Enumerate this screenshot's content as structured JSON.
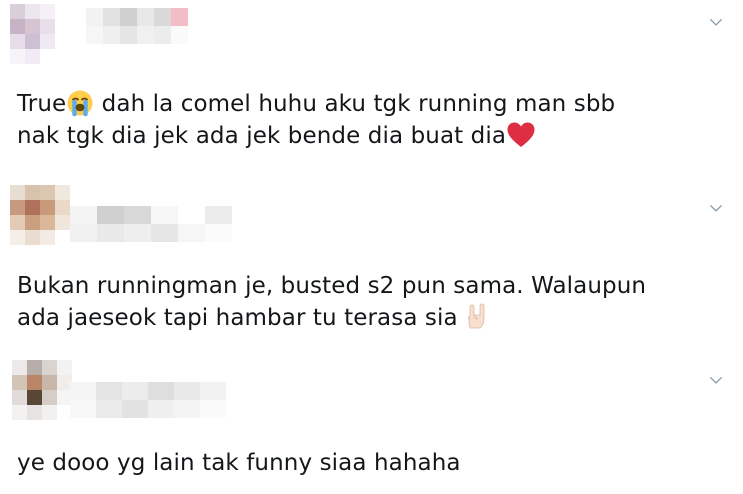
{
  "replies": [
    {
      "line1_before": "True",
      "line1_emoji": "loudly-crying-face-emoji",
      "line1_after": " dah la comel huhu aku tgk running man sbb",
      "line2_before": "nak tgk dia jek ada jek bende dia buat dia",
      "line2_emoji": "red-heart-emoji",
      "avatar_colors": [
        "#d9cfda",
        "#ece6ee",
        "#f4f0f6",
        "#ffffff",
        "#c8b3c6",
        "#d6c4d3",
        "#e8dfea",
        "#ffffff",
        "#e6dcea",
        "#cdbfd4",
        "#efe9f3",
        "#ffffff",
        "#f7f4f9",
        "#f0ebf4",
        "#ffffff",
        "#ffffff"
      ],
      "name_colors": [
        "#f2f2f2",
        "#e1e1e1",
        "#cfcfcf",
        "#e8e8e8",
        "#d9d9d9",
        "#f3bcc6",
        "#f6f6f6",
        "#efefef",
        "#e5e5e5",
        "#f0f0f0",
        "#ececec",
        "#fafafa"
      ]
    },
    {
      "line1": "Bukan runningman je, busted s2 pun sama. Walaupun",
      "line2_before": "ada jaeseok tapi hambar tu terasa sia",
      "line2_emoji": "sign-of-horns-emoji",
      "avatar_colors": [
        "#e8ddd2",
        "#d8c2ad",
        "#dcc7b1",
        "#f0e7de",
        "#c79a80",
        "#b0705a",
        "#c89a7a",
        "#ead9c9",
        "#e3cbb5",
        "#cc9e80",
        "#dcb89a",
        "#f1e6dc",
        "#f5eee7",
        "#eadcd0",
        "#f3ebe3",
        "#ffffff"
      ],
      "name_colors": [
        "#f4f4f4",
        "#cfcfcf",
        "#d8d8d8",
        "#f7f7f7",
        "#ffffff",
        "#ececec",
        "#f1f1f1",
        "#e9e9e9",
        "#eeeeee",
        "#e6e6e6",
        "#f6f6f6",
        "#fbfbfb"
      ]
    },
    {
      "line1": "ye dooo yg lain tak funny siaa hahaha",
      "avatar_colors": [
        "#ece9e8",
        "#b8aea9",
        "#dad4d0",
        "#f4f2f1",
        "#d3c4b8",
        "#b98768",
        "#c8b6a9",
        "#f0edeb",
        "#e1dcd9",
        "#584636",
        "#d5cdc7",
        "#f6f5f4",
        "#f3f2f1",
        "#e6e3e1",
        "#f2f1f0",
        "#ffffff"
      ],
      "name_colors": [
        "#f5f5f5",
        "#e4e4e4",
        "#ececec",
        "#dedede",
        "#e9e9e9",
        "#f2f2f2",
        "#f8f8f8",
        "#eaeaea",
        "#e2e2e2",
        "#efefef",
        "#f4f4f4",
        "#fafafa"
      ]
    }
  ]
}
